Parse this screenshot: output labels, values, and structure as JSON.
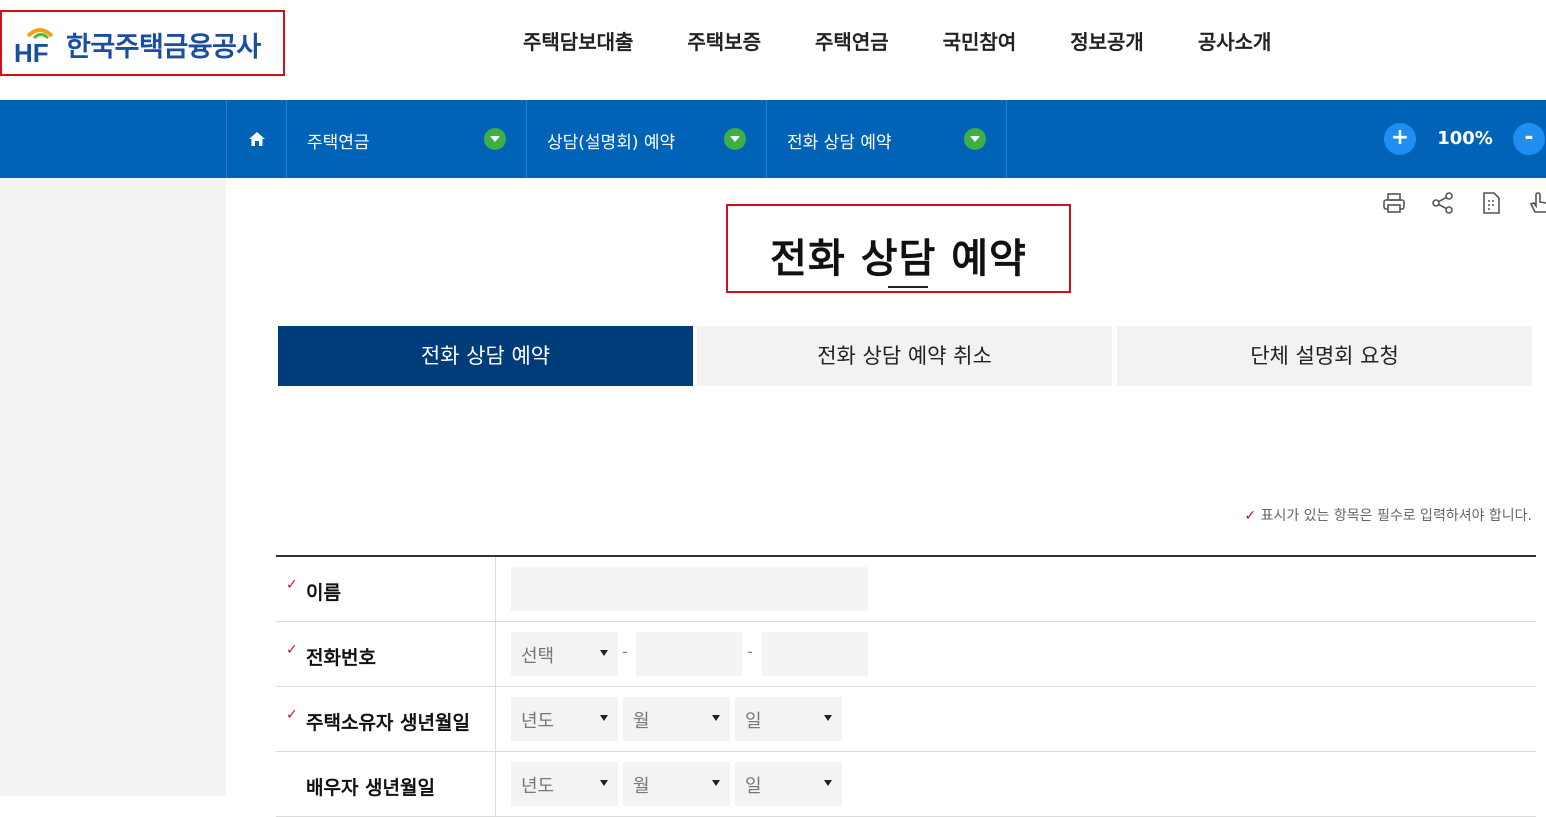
{
  "brand": {
    "name": "한국주택금융공사",
    "mark": "HF"
  },
  "gnb": [
    "주택담보대출",
    "주택보증",
    "주택연금",
    "국민참여",
    "정보공개",
    "공사소개"
  ],
  "location": {
    "home_icon": "home-icon",
    "items": [
      "주택연금",
      "상담(설명회) 예약",
      "전화 상담 예약"
    ],
    "zoom_in": "+",
    "zoom_value": "100%",
    "zoom_out": "-"
  },
  "utilities": [
    "print-icon",
    "share-icon",
    "document-icon",
    "touch-icon"
  ],
  "page_title": "전화 상담 예약",
  "tabs": [
    {
      "label": "전화 상담 예약",
      "active": true
    },
    {
      "label": "전화 상담 예약 취소",
      "active": false
    },
    {
      "label": "단체 설명회 요청",
      "active": false
    }
  ],
  "required_note": "표시가 있는 항목은 필수로 입력하셔야 합니다.",
  "check_mark": "✓",
  "form": {
    "name_label": "이름",
    "phone_label": "전화번호",
    "phone_select": "선택",
    "dash": "-",
    "owner_birth_label": "주택소유자 생년월일",
    "spouse_birth_label": "배우자 생년월일",
    "year": "년도",
    "month": "월",
    "day": "일"
  },
  "colors": {
    "accent": "#0063b8",
    "active_tab": "#003b7a",
    "required": "#c8102e",
    "highlight_border": "#d0101a",
    "chevron": "#3cb043"
  }
}
